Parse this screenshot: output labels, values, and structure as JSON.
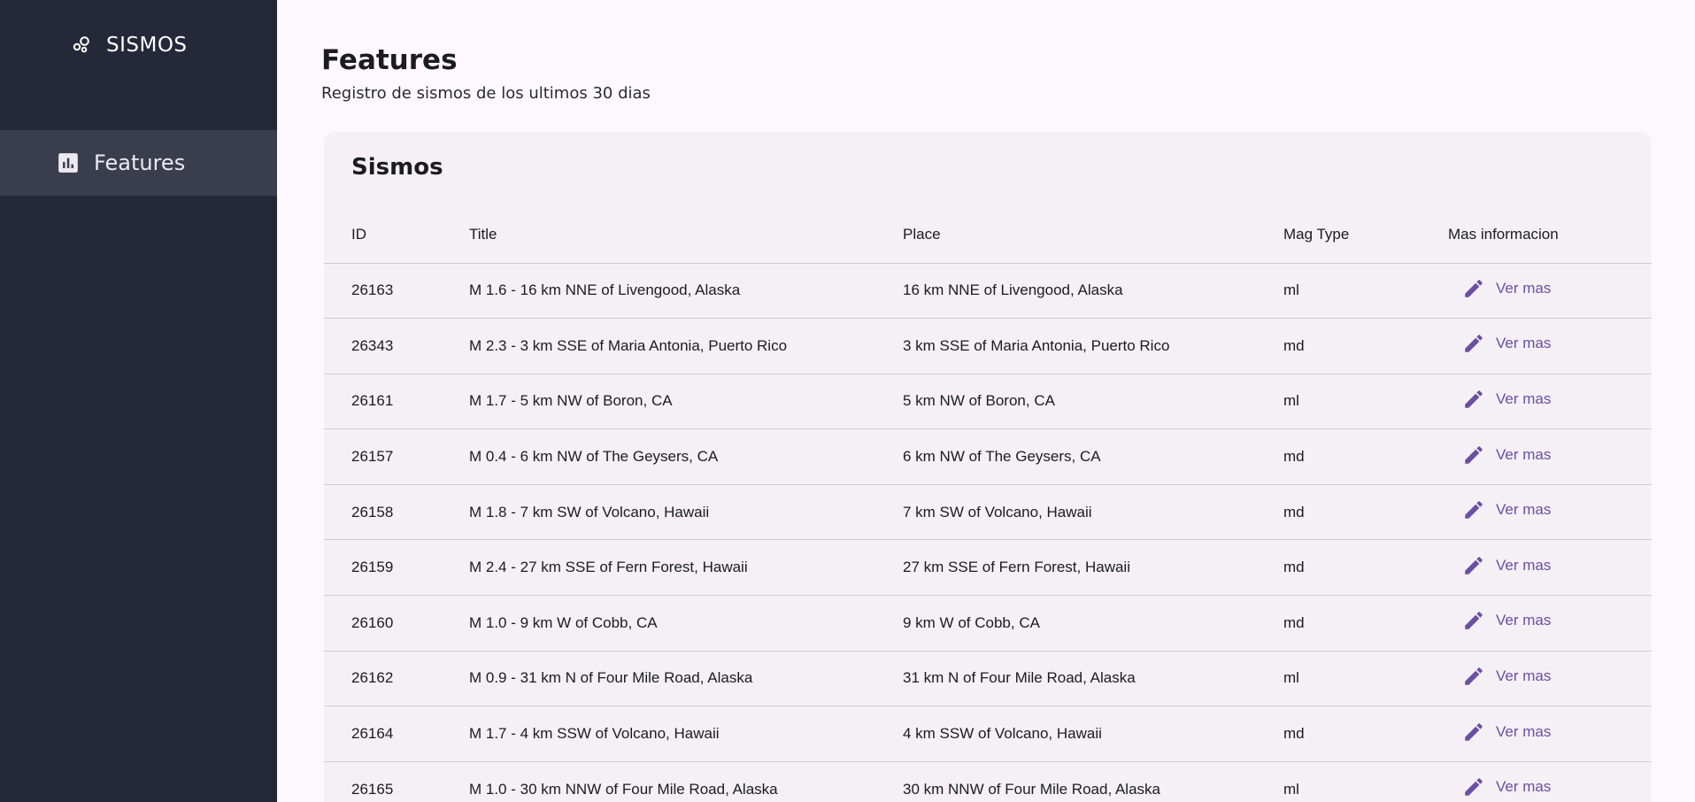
{
  "sidebar": {
    "brand": "SISMOS",
    "items": [
      {
        "label": "Features",
        "icon": "bar-chart-icon"
      }
    ]
  },
  "header": {
    "title": "Features",
    "subtitle": "Registro de sismos de los ultimos 30 dias"
  },
  "card": {
    "title": "Sismos",
    "columns": [
      "ID",
      "Title",
      "Place",
      "Mag Type",
      "Mas informacion"
    ],
    "action_label": "Ver mas",
    "rows": [
      {
        "id": "26163",
        "title": "M 1.6 - 16 km NNE of Livengood, Alaska",
        "place": "16 km NNE of Livengood, Alaska",
        "mag_type": "ml"
      },
      {
        "id": "26343",
        "title": "M 2.3 - 3 km SSE of Maria Antonia, Puerto Rico",
        "place": "3 km SSE of Maria Antonia, Puerto Rico",
        "mag_type": "md"
      },
      {
        "id": "26161",
        "title": "M 1.7 - 5 km NW of Boron, CA",
        "place": "5 km NW of Boron, CA",
        "mag_type": "ml"
      },
      {
        "id": "26157",
        "title": "M 0.4 - 6 km NW of The Geysers, CA",
        "place": "6 km NW of The Geysers, CA",
        "mag_type": "md"
      },
      {
        "id": "26158",
        "title": "M 1.8 - 7 km SW of Volcano, Hawaii",
        "place": "7 km SW of Volcano, Hawaii",
        "mag_type": "md"
      },
      {
        "id": "26159",
        "title": "M 2.4 - 27 km SSE of Fern Forest, Hawaii",
        "place": "27 km SSE of Fern Forest, Hawaii",
        "mag_type": "md"
      },
      {
        "id": "26160",
        "title": "M 1.0 - 9 km W of Cobb, CA",
        "place": "9 km W of Cobb, CA",
        "mag_type": "md"
      },
      {
        "id": "26162",
        "title": "M 0.9 - 31 km N of Four Mile Road, Alaska",
        "place": "31 km N of Four Mile Road, Alaska",
        "mag_type": "ml"
      },
      {
        "id": "26164",
        "title": "M 1.7 - 4 km SSW of Volcano, Hawaii",
        "place": "4 km SSW of Volcano, Hawaii",
        "mag_type": "md"
      },
      {
        "id": "26165",
        "title": "M 1.0 - 30 km NNW of Four Mile Road, Alaska",
        "place": "30 km NNW of Four Mile Road, Alaska",
        "mag_type": "ml"
      }
    ]
  },
  "colors": {
    "sidebar_bg": "#252839",
    "sidebar_active": "#3a3d4e",
    "page_bg": "#fdf8fd",
    "card_bg": "#f4f0f6",
    "accent": "#6a4fa3"
  }
}
